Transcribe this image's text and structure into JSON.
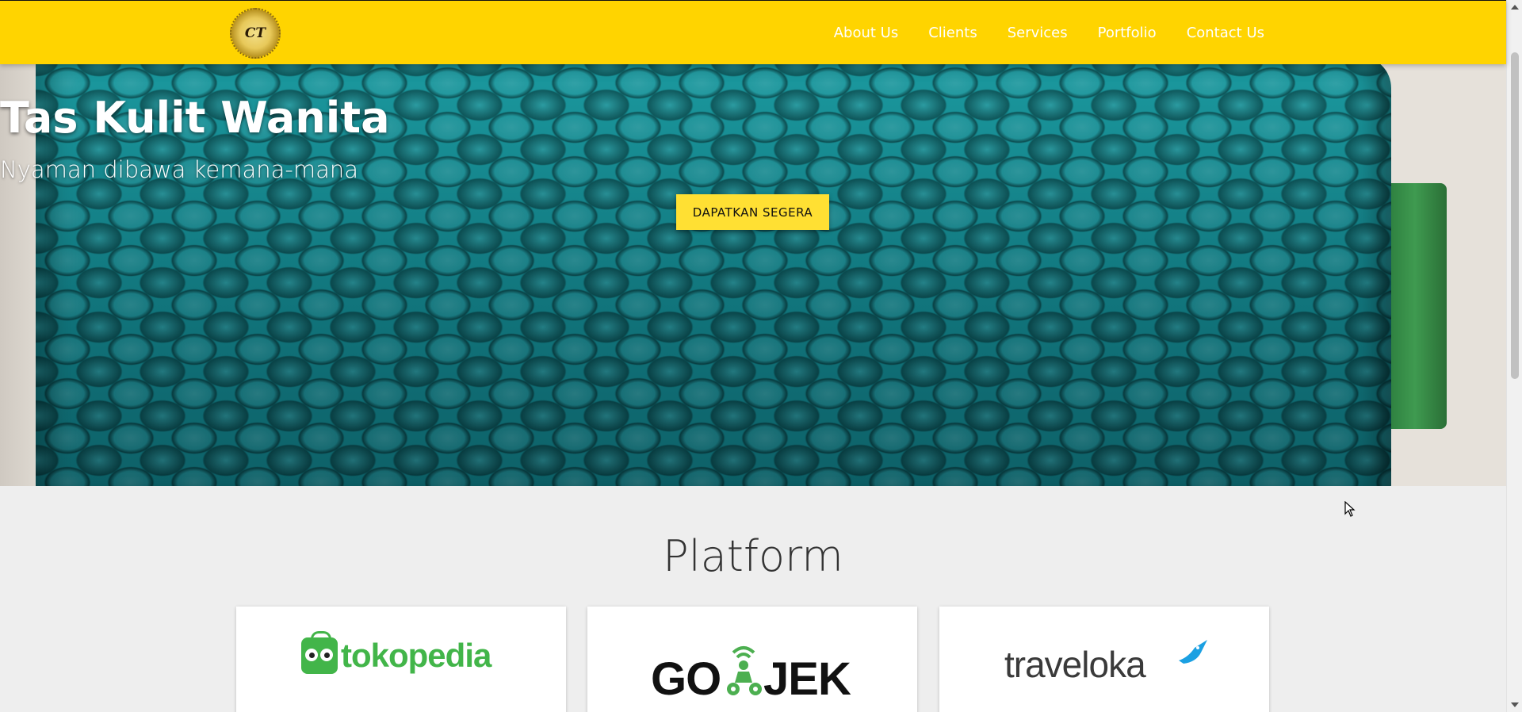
{
  "navbar": {
    "logo_text": "CT",
    "links": [
      "About Us",
      "Clients",
      "Services",
      "Portfolio",
      "Contact Us"
    ],
    "background_color": "#ffd400"
  },
  "hero": {
    "title": "Tas Kulit Wanita",
    "subtitle": "Nyaman dibawa kemana-mana",
    "cta_label": "DAPATKAN SEGERA",
    "cta_color": "#ffe033"
  },
  "platform": {
    "title": "Platform",
    "cards": [
      {
        "name": "tokopedia",
        "logo_text": "tokopedia",
        "color": "#42b549"
      },
      {
        "name": "gojek",
        "logo_text_left": "GO",
        "logo_text_right": "JEK",
        "color": "#111111"
      },
      {
        "name": "traveloka",
        "logo_text": "traveloka",
        "color": "#3a3a3a"
      }
    ]
  }
}
